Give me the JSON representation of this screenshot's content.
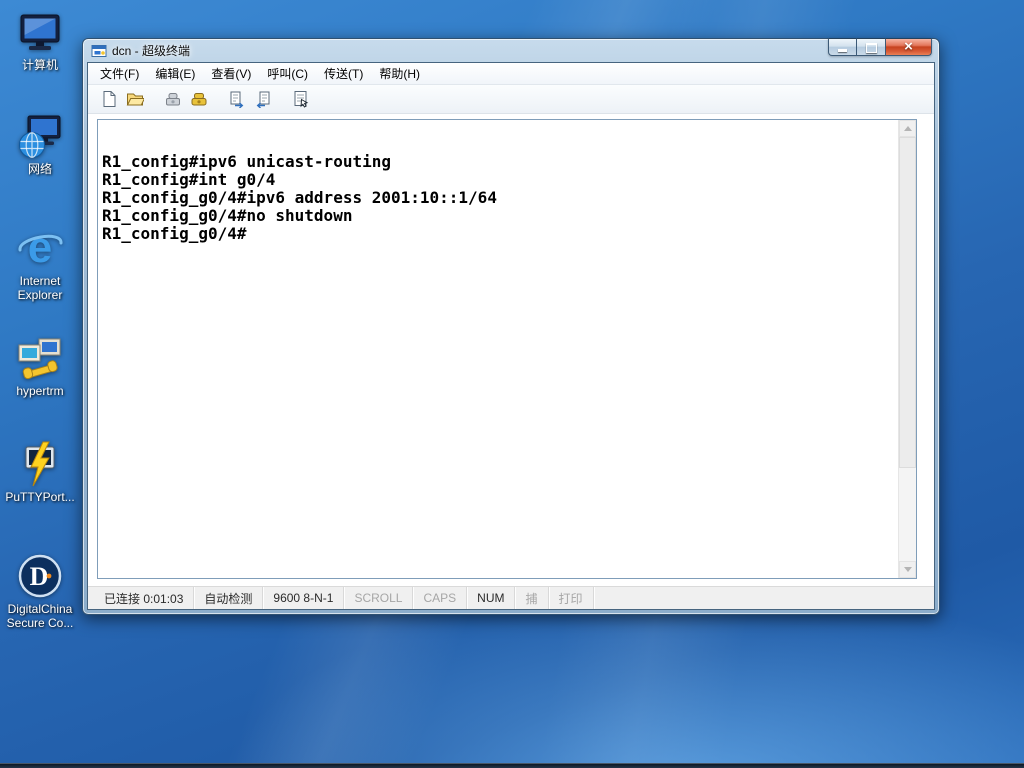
{
  "desktop": {
    "icons": [
      {
        "name": "computer",
        "label": "计算机"
      },
      {
        "name": "network",
        "label": "网络"
      },
      {
        "name": "internet-explorer",
        "label": "Internet Explorer"
      },
      {
        "name": "hypertrm",
        "label": "hypertrm"
      },
      {
        "name": "putty",
        "label": "PuTTYPort..."
      },
      {
        "name": "digitalchina",
        "label": "DigitalChina Secure Co..."
      }
    ]
  },
  "window": {
    "title": "dcn - 超级终端",
    "controls": {
      "minimize": "minimize",
      "maximize": "maximize",
      "close_glyph": "×"
    },
    "menu": {
      "items": [
        {
          "label": "文件(F)"
        },
        {
          "label": "编辑(E)"
        },
        {
          "label": "查看(V)"
        },
        {
          "label": "呼叫(C)"
        },
        {
          "label": "传送(T)"
        },
        {
          "label": "帮助(H)"
        }
      ]
    },
    "toolbar": {
      "icons": [
        "new-document",
        "open-folder",
        "call",
        "disconnect",
        "send",
        "receive",
        "properties"
      ]
    },
    "terminal": {
      "lines": [
        "R1_config#ipv6 unicast-routing",
        "R1_config#int g0/4",
        "R1_config_g0/4#ipv6 address 2001:10::1/64",
        "R1_config_g0/4#no shutdown",
        "R1_config_g0/4#"
      ]
    },
    "statusbar": {
      "connection": "已连接 0:01:03",
      "detection": "自动检测",
      "settings": "9600 8-N-1",
      "scroll": "SCROLL",
      "caps": "CAPS",
      "num": "NUM",
      "capture": "捕",
      "print": "打印"
    }
  }
}
